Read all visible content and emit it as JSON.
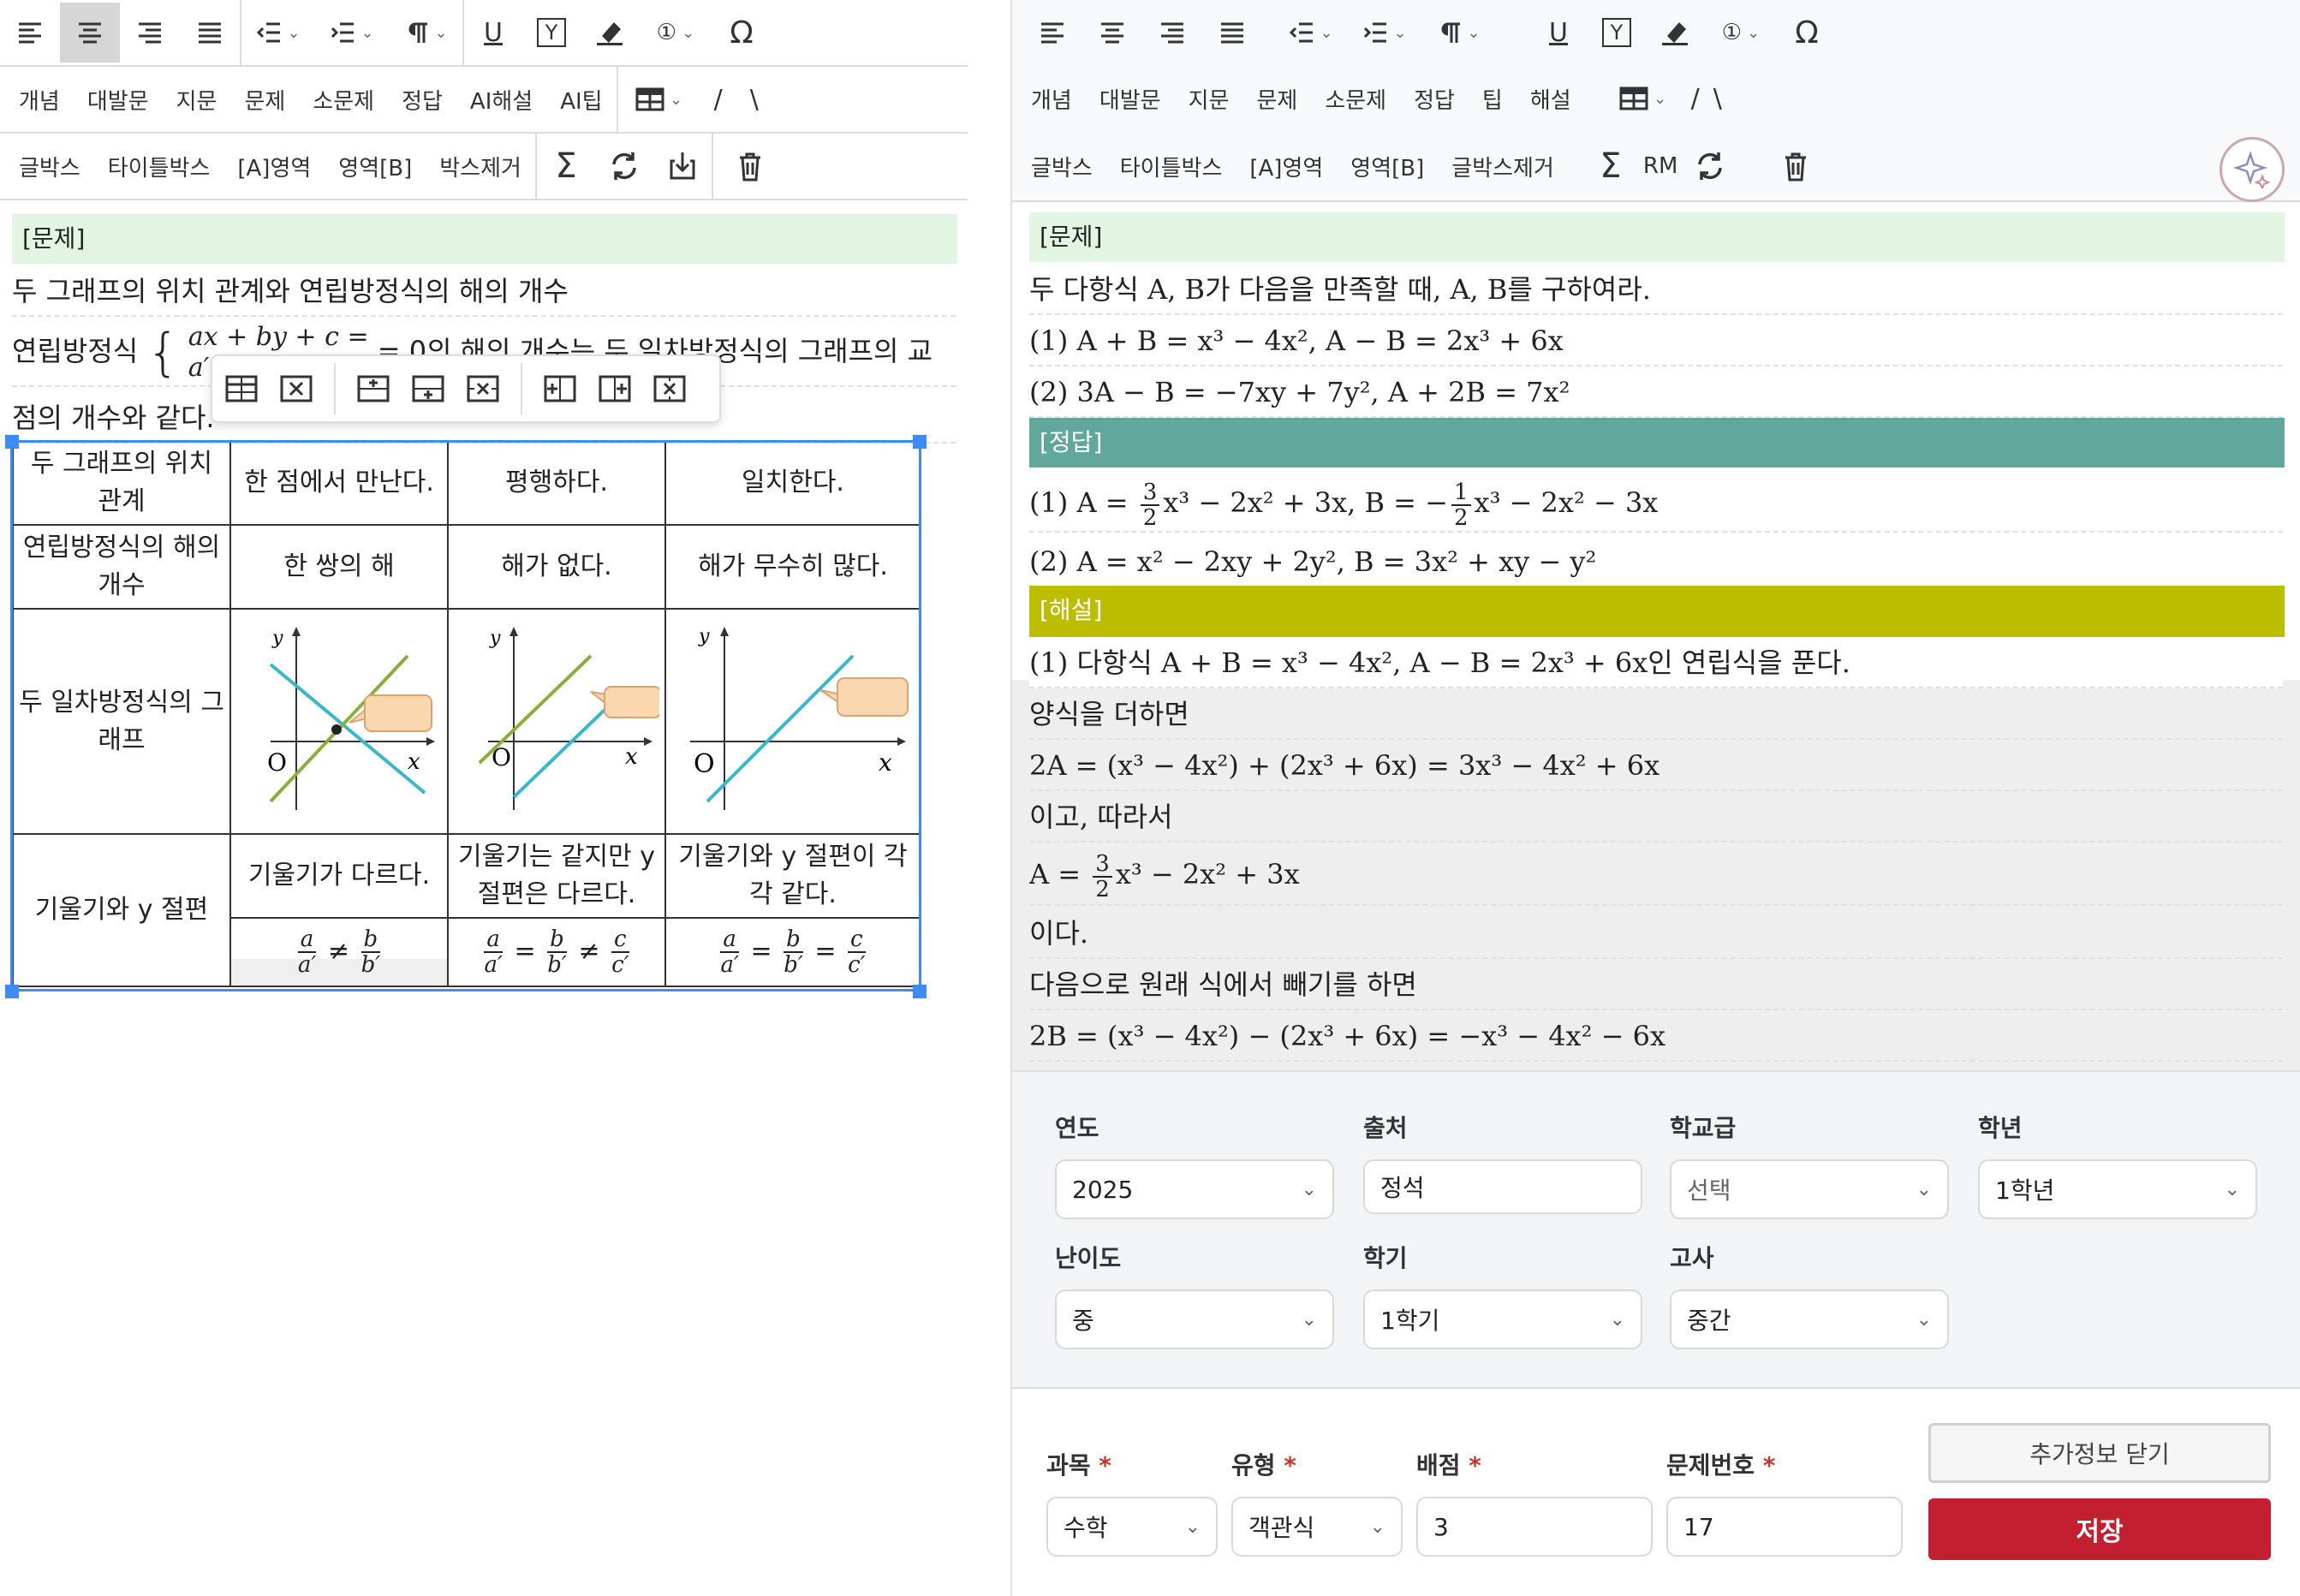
{
  "toolbar_left": {
    "row2": [
      "개념",
      "대발문",
      "지문",
      "문제",
      "소문제",
      "정답",
      "AI해설",
      "AI팁"
    ],
    "row3": [
      "글박스",
      "타이틀박스",
      "[A]영역",
      "영역[B]",
      "박스제거"
    ]
  },
  "toolbar_right": {
    "row2": [
      "개념",
      "대발문",
      "지문",
      "문제",
      "소문제",
      "정답",
      "팁",
      "해설"
    ],
    "row3": [
      "글박스",
      "타이틀박스",
      "[A]영역",
      "영역[B]",
      "글박스제거"
    ],
    "rm_label": "RM"
  },
  "slash_labels": [
    "/",
    "\\"
  ],
  "symbols": {
    "sigma": "Σ",
    "omega": "Ω",
    "circled_one": "①",
    "underline": "U",
    "box_y": "Y"
  },
  "left_doc": {
    "section": "[문제]",
    "line1": "두 그래프의 위치 관계와 연립방정식의 해의 개수",
    "line2_prefix": "연립방정식",
    "line2_eq1": "ax + by + c =",
    "line2_eq2": "a′",
    "line2_suffix": "= 0의 해의 개수는 두 일차방정식의 그래프의 교",
    "line3": "점의 개수와 같다.",
    "table": {
      "row_headers": [
        "두 그래프의 위치 관계",
        "연립방정식의 해의 개수",
        "두 일차방정식의 그래프",
        "기울기와 y 절편"
      ],
      "positions": [
        "한 점에서 만난다.",
        "평행하다.",
        "일치한다."
      ],
      "solutions": [
        "한 쌍의 해",
        "해가 없다.",
        "해가 무수히 많다."
      ],
      "slopes": [
        "기울기가 다르다.",
        "기울기는 같지만 y 절편은 다르다.",
        "기울기와 y 절편이 각각 같다."
      ],
      "graph_labels": {
        "x": "x",
        "y": "y",
        "origin": "O"
      },
      "ratios": [
        {
          "n1": "a",
          "d1": "a′",
          "op1": "≠",
          "n2": "b",
          "d2": "b′"
        },
        {
          "n1": "a",
          "d1": "a′",
          "op1": "=",
          "n2": "b",
          "d2": "b′",
          "op2": "≠",
          "n3": "c",
          "d3": "c′"
        },
        {
          "n1": "a",
          "d1": "a′",
          "op1": "=",
          "n2": "b",
          "d2": "b′",
          "op2": "=",
          "n3": "c",
          "d3": "c′"
        }
      ]
    }
  },
  "right_doc": {
    "problem_header": "[문제]",
    "problem_line": "두 다항식 A, B가 다음을 만족할 때, A, B를 구하여라.",
    "problem_1": "(1) A + B = x³ − 4x², A − B = 2x³ + 6x",
    "problem_2": "(2) 3A − B = −7xy + 7y², A + 2B = 7x²",
    "answer_header": "[정답]",
    "answer_1_prefix": "(1) A = ",
    "answer_1_mid": "x³ − 2x² + 3x, B = −",
    "answer_1_end": "x³ − 2x² − 3x",
    "answer_2": "(2) A = x² − 2xy + 2y², B = 3x² + xy − y²",
    "answer_frac_num": "3",
    "answer_frac_den": "2",
    "answer_frac2_num": "1",
    "answer_frac2_den": "2",
    "solution_header": "[해설]",
    "solution_lines": [
      "(1) 다항식 A + B = x³ − 4x², A − B = 2x³ + 6x인 연립식을 푼다.",
      "양식을 더하면",
      "2A = (x³ − 4x²) + (2x³ + 6x) = 3x³ − 4x² + 6x",
      "이고, 따라서",
      "x³ − 2x² + 3x",
      "이다.",
      "다음으로 원래 식에서 빼기를 하면",
      "2B = (x³ − 4x²) − (2x³ + 6x) = −x³ − 4x² − 6x"
    ],
    "sol_a_prefix": "A = "
  },
  "meta_form": {
    "year": {
      "label": "연도",
      "value": "2025"
    },
    "source": {
      "label": "출처",
      "value": "정석"
    },
    "school": {
      "label": "학교급",
      "value": "선택"
    },
    "grade": {
      "label": "학년",
      "value": "1학년"
    },
    "difficulty": {
      "label": "난이도",
      "value": "중"
    },
    "semester": {
      "label": "학기",
      "value": "1학기"
    },
    "exam": {
      "label": "고사",
      "value": "중간"
    }
  },
  "bottom_form": {
    "subject": {
      "label": "과목",
      "value": "수학"
    },
    "type": {
      "label": "유형",
      "value": "객관식"
    },
    "score": {
      "label": "배점",
      "value": "3"
    },
    "number": {
      "label": "문제번호",
      "value": "17"
    },
    "required_mark": "*",
    "close_button": "추가정보 닫기",
    "save_button": "저장"
  },
  "colors": {
    "problem_bg": "#e2f5e2",
    "answer_bg": "#61a79c",
    "solution_bg": "#bdbd00",
    "save": "#c21f30",
    "selection": "#3b8cf5",
    "graph_blue": "#3ab7c9",
    "graph_green": "#8aae3b",
    "bubble": "#fbd7b0"
  }
}
